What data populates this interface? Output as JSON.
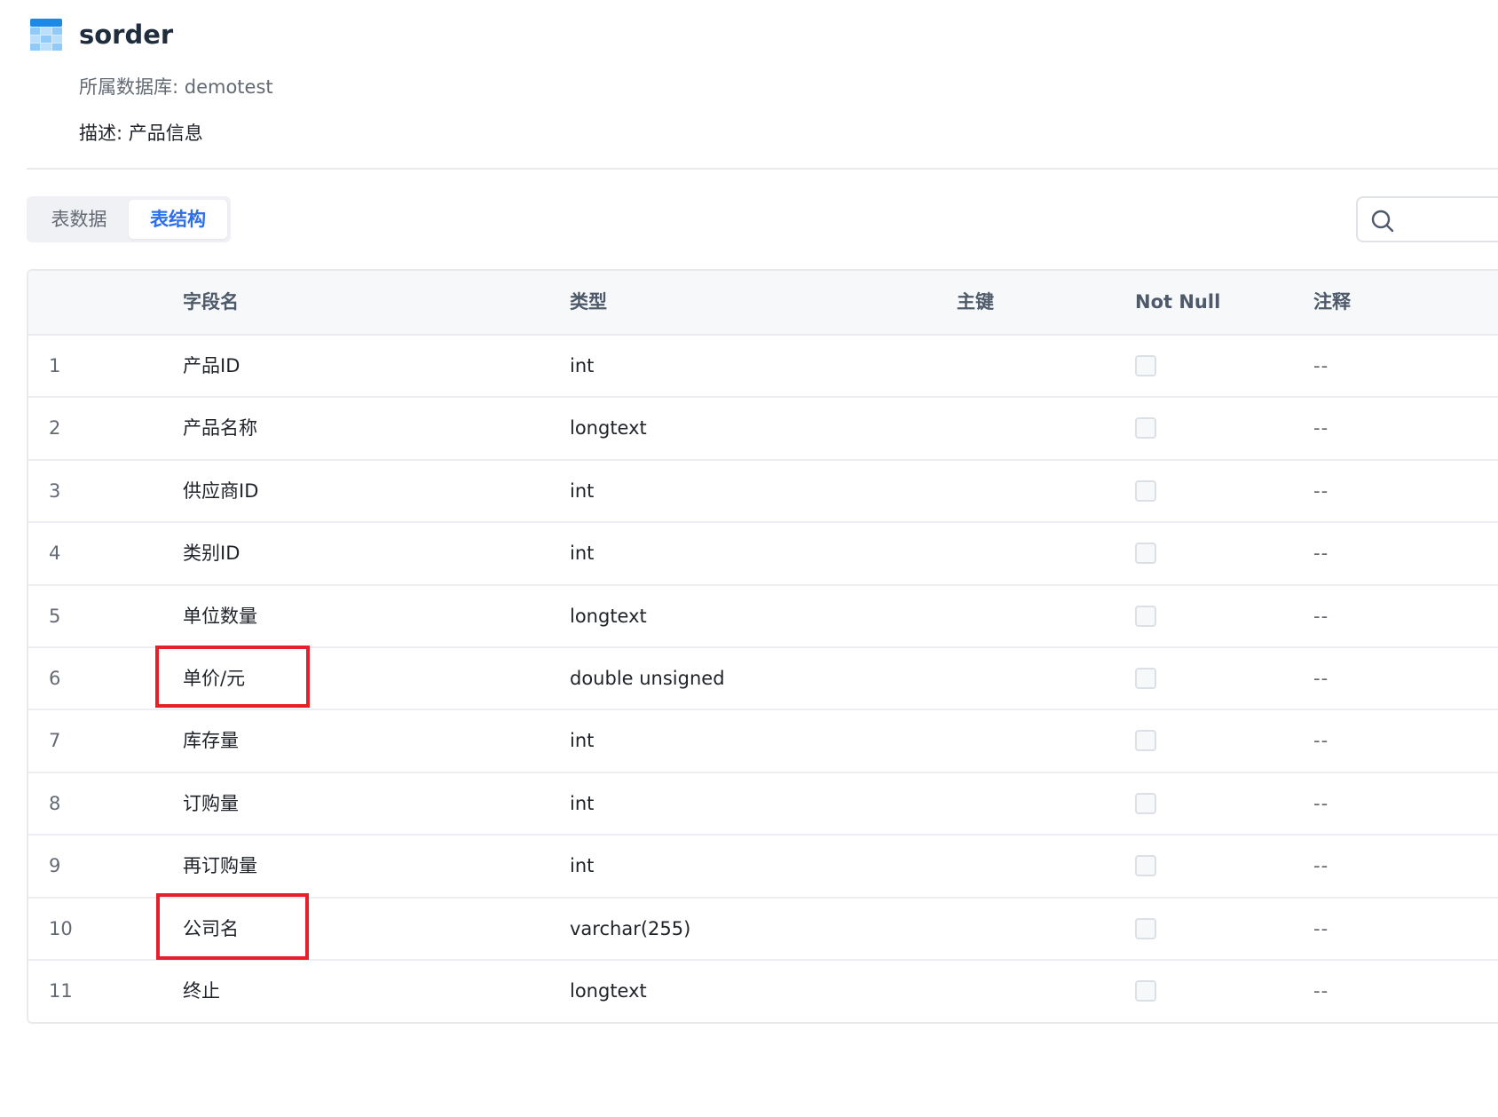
{
  "header": {
    "title": "sorder",
    "icon": "table-icon",
    "database_label": "所属数据库: demotest",
    "description_label": "描述: 产品信息"
  },
  "tabs": [
    {
      "label": "表数据",
      "active": false
    },
    {
      "label": "表结构",
      "active": true
    }
  ],
  "search": {
    "icon": "search-icon"
  },
  "table": {
    "columns": [
      "",
      "字段名",
      "类型",
      "主键",
      "Not Null",
      "注释"
    ],
    "rows": [
      {
        "index": "1",
        "name": "产品ID",
        "type": "int",
        "primary_key": false,
        "not_null": false,
        "comment": "--"
      },
      {
        "index": "2",
        "name": "产品名称",
        "type": "longtext",
        "primary_key": false,
        "not_null": false,
        "comment": "--"
      },
      {
        "index": "3",
        "name": "供应商ID",
        "type": "int",
        "primary_key": false,
        "not_null": false,
        "comment": "--"
      },
      {
        "index": "4",
        "name": "类别ID",
        "type": "int",
        "primary_key": false,
        "not_null": false,
        "comment": "--"
      },
      {
        "index": "5",
        "name": "单位数量",
        "type": "longtext",
        "primary_key": false,
        "not_null": false,
        "comment": "--"
      },
      {
        "index": "6",
        "name": "单价/元",
        "type": "double unsigned",
        "primary_key": false,
        "not_null": false,
        "comment": "--"
      },
      {
        "index": "7",
        "name": "库存量",
        "type": "int",
        "primary_key": false,
        "not_null": false,
        "comment": "--"
      },
      {
        "index": "8",
        "name": "订购量",
        "type": "int",
        "primary_key": false,
        "not_null": false,
        "comment": "--"
      },
      {
        "index": "9",
        "name": "再订购量",
        "type": "int",
        "primary_key": false,
        "not_null": false,
        "comment": "--"
      },
      {
        "index": "10",
        "name": "公司名",
        "type": "varchar(255)",
        "primary_key": false,
        "not_null": false,
        "comment": "--"
      },
      {
        "index": "11",
        "name": "终止",
        "type": "longtext",
        "primary_key": false,
        "not_null": false,
        "comment": "--"
      }
    ]
  },
  "highlights": [
    {
      "row_index": "6",
      "field": "单价/元",
      "color": "#e5202b"
    },
    {
      "row_index": "10",
      "field": "公司名",
      "color": "#e5202b"
    }
  ],
  "colors": {
    "accent": "#2f6fe8",
    "highlight": "#e5202b",
    "header_bg": "#f6f8fa"
  }
}
